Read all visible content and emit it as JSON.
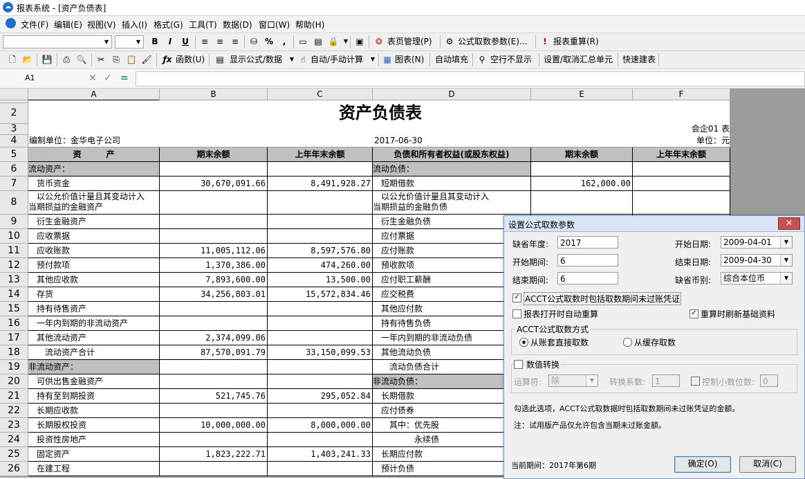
{
  "window": {
    "title": "报表系统 - [资产负债表]"
  },
  "menu": [
    "文件(F)",
    "编辑(E)",
    "视图(V)",
    "插入(I)",
    "格式(G)",
    "工具(T)",
    "数据(D)",
    "窗口(W)",
    "帮助(H)"
  ],
  "toolbar1": {
    "bold": "B",
    "italic": "I",
    "underline": "U",
    "percent": "%",
    "comma": ",",
    "page_mgmt": "表页管理(P)",
    "formula_params": "公式取数参数(E)...",
    "recalc": "报表重算(R)"
  },
  "toolbar2": {
    "func": "函数(U)",
    "show_formula": "显示公式/数据",
    "auto_manual": "自动/手动计算",
    "chart": "图表(N)",
    "autofill": "自动填充",
    "hide_empty": "空行不显示",
    "set_total": "设置/取消汇总单元",
    "quick_build": "快速建表"
  },
  "formula": {
    "cell_ref": "A1",
    "cancel": "✕",
    "confirm": "✓",
    "equals": "="
  },
  "columns": [
    "A",
    "B",
    "C",
    "D",
    "E",
    "F"
  ],
  "report": {
    "title": "资产负债表",
    "form_code": "会企01 表",
    "unit_label": "编制单位：金华电子公司",
    "date": "2017-06-30",
    "currency": "单位：元",
    "headers": [
      "资　　　产",
      "期末余额",
      "上年年末余额",
      "负债和所有者权益(或股东权益)",
      "期末余额",
      "上年年末余额"
    ],
    "rows": [
      {
        "n": "5"
      },
      {
        "n": "6",
        "a": "流动资产：",
        "b": "",
        "c": "",
        "d": "流动负债：",
        "e": "",
        "ahd": true,
        "dhd": true
      },
      {
        "n": "7",
        "a": "　货币资金",
        "b": "30,670,091.66",
        "c": "8,491,928.27",
        "d": "　短期借款",
        "e": "162,000.00"
      },
      {
        "n": "8",
        "a": "　以公允价值计量且其变动计入",
        "a2": "当期损益的金融资产",
        "b": "",
        "c": "",
        "d": "　以公允价值计量且其变动计入",
        "d2": "当期损益的金融负债",
        "e": ""
      },
      {
        "n": "9",
        "a": "　衍生金融资产",
        "b": "",
        "c": "",
        "d": "　衍生金融负债",
        "e": ""
      },
      {
        "n": "10",
        "a": "　应收票据",
        "b": "",
        "c": "",
        "d": "　应付票据",
        "e": ""
      },
      {
        "n": "11",
        "a": "　应收账款",
        "b": "11,005,112.06",
        "c": "8,597,576.80",
        "d": "　应付账款",
        "e": ""
      },
      {
        "n": "12",
        "a": "　预付款项",
        "b": "1,370,386.00",
        "c": "474,260.00",
        "d": "　预收款项",
        "e": ""
      },
      {
        "n": "13",
        "a": "　其他应收款",
        "b": "7,893,600.00",
        "c": "13,500.00",
        "d": "　应付职工薪酬",
        "e": ""
      },
      {
        "n": "14",
        "a": "　存货",
        "b": "34,256,803.01",
        "c": "15,572,834.46",
        "d": "　应交税费",
        "e": ""
      },
      {
        "n": "15",
        "a": "　持有待售资产",
        "b": "",
        "c": "",
        "d": "　其他应付款",
        "e": ""
      },
      {
        "n": "16",
        "a": "　一年内到期的非流动资产",
        "b": "",
        "c": "",
        "d": "　持有待售负债",
        "e": ""
      },
      {
        "n": "17",
        "a": "　其他流动资产",
        "b": "2,374,099.06",
        "c": "",
        "d": "　一年内到期的非流动负债",
        "e": ""
      },
      {
        "n": "18",
        "a": "　　流动资产合计",
        "b": "87,570,091.79",
        "c": "33,150,099.53",
        "d": "　其他流动负债",
        "e": ""
      },
      {
        "n": "19",
        "a": "非流动资产：",
        "b": "",
        "c": "",
        "d": "　　流动负债合计",
        "e": "",
        "ahd": true
      },
      {
        "n": "20",
        "a": "　可供出售金融资产",
        "b": "",
        "c": "",
        "d": "非流动负债：",
        "e": "",
        "dhd": true
      },
      {
        "n": "21",
        "a": "　持有至到期投资",
        "b": "521,745.76",
        "c": "295,052.84",
        "d": "　长期借款",
        "e": ""
      },
      {
        "n": "22",
        "a": "　长期应收款",
        "b": "",
        "c": "",
        "d": "　应付债券",
        "e": ""
      },
      {
        "n": "23",
        "a": "　长期股权投资",
        "b": "10,000,000.00",
        "c": "8,000,000.00",
        "d": "　　其中：优先股",
        "e": ""
      },
      {
        "n": "24",
        "a": "　投资性房地产",
        "b": "",
        "c": "",
        "d": "　　　　　永续债",
        "e": ""
      },
      {
        "n": "25",
        "a": "　固定资产",
        "b": "1,823,222.71",
        "c": "1,403,241.33",
        "d": "　长期应付款",
        "e": ""
      },
      {
        "n": "26",
        "a": "　在建工程",
        "b": "",
        "c": "",
        "d": "　预计负债",
        "e": ""
      }
    ]
  },
  "dialog": {
    "title": "设置公式取数参数",
    "close": "✕",
    "default_year_label": "缺省年度:",
    "default_year": "2017",
    "start_period_label": "开始期间:",
    "start_period": "6",
    "end_period_label": "结束期间:",
    "end_period": "6",
    "start_date_label": "开始日期:",
    "start_date": "2009-04-01",
    "end_date_label": "结束日期:",
    "end_date": "2009-04-30",
    "currency_label": "缺省币别:",
    "currency": "综合本位币",
    "acct_unposted": "ACCT公式取数时包括取数期间未过账凭证",
    "auto_recalc": "报表打开时自动重算",
    "refresh_basic": "重算时刷新基础资料",
    "acct_method_group": "ACCT公式取数方式",
    "from_books": "从账套直接取数",
    "from_cache": "从缓存取数",
    "num_convert": "数值转换",
    "operator_label": "运算符:",
    "operator": "除",
    "factor_label": "转换系数:",
    "factor": "1",
    "decimals_label": "控制小数位数:",
    "decimals": "0",
    "note1": "勾选此选项，ACCT公式取数据时包括取数期间未过账凭证的金额。",
    "note2": "注：试用版产品仅允许包含当期未过账金额。",
    "current_period": "当前期间：2017年第6期",
    "ok": "确定(O)",
    "cancel": "取消(C)"
  }
}
